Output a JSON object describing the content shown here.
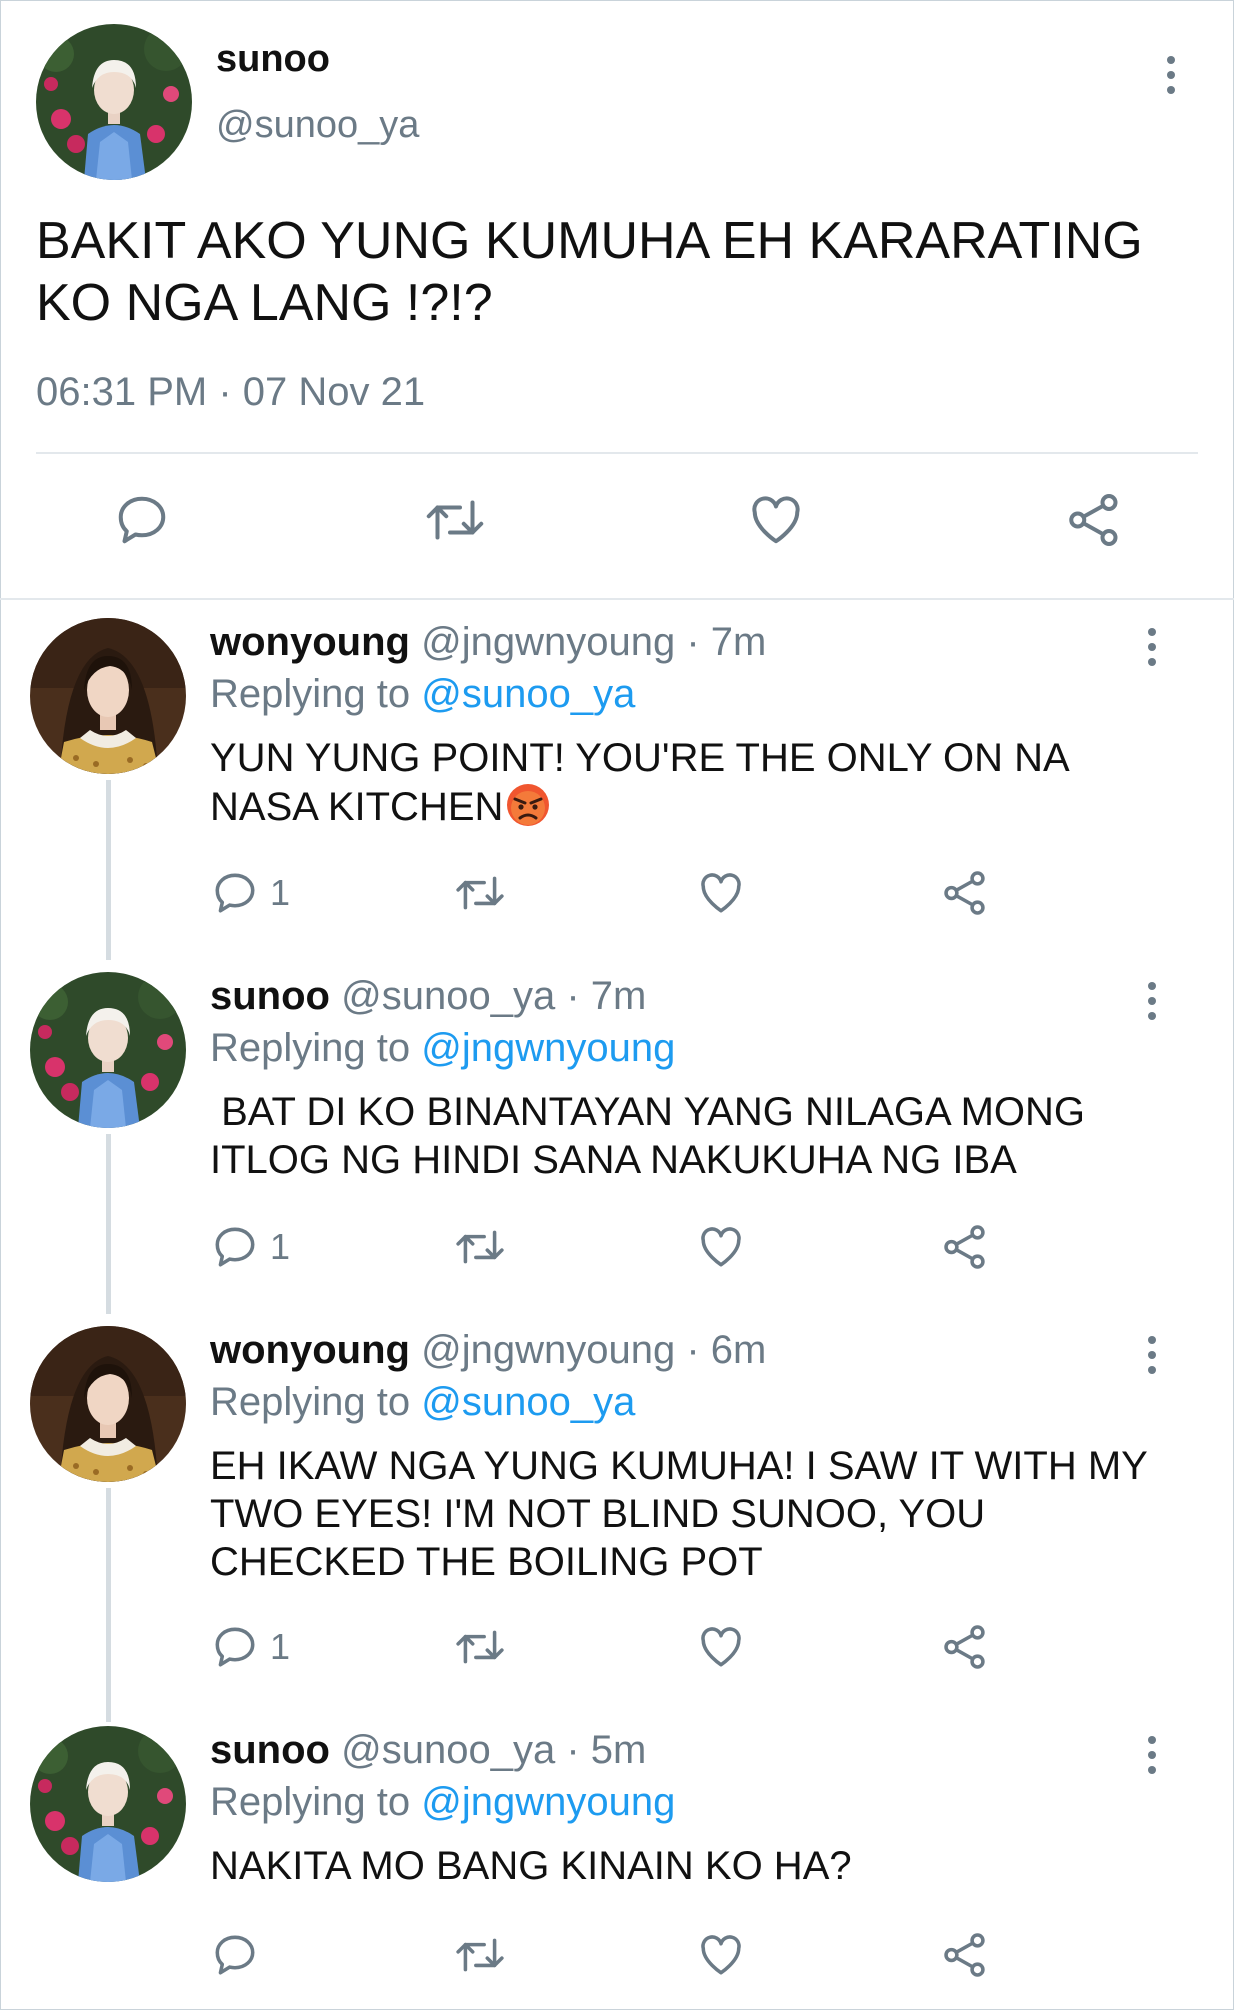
{
  "main_tweet": {
    "name": "sunoo",
    "handle": "@sunoo_ya",
    "text": "BAKIT AKO YUNG KUMUHA EH KARARATING KO NGA LANG !?!?",
    "timestamp": "06:31 PM · 07 Nov 21",
    "actions": [
      "comment-icon",
      "retweet-icon",
      "heart-icon",
      "share-icon"
    ]
  },
  "replies": [
    {
      "name": "wonyoung",
      "handle": "@jngwnyoung",
      "time": "· 7m",
      "replying_label": "Replying to",
      "replying_to": "@sunoo_ya",
      "text": "YUN YUNG POINT! YOU'RE THE ONLY ON NA NASA KITCHEN",
      "emoji": "angry-face-emoji",
      "comment_count": "1"
    },
    {
      "name": "sunoo",
      "handle": "@sunoo_ya",
      "time": "· 7m",
      "replying_label": "Replying to",
      "replying_to": "@jngwnyoung",
      "text": " BAT DI KO BINANTAYAN YANG NILAGA MONG ITLOG NG HINDI SANA NAKUKUHA NG IBA",
      "comment_count": "1"
    },
    {
      "name": "wonyoung",
      "handle": "@jngwnyoung",
      "time": "· 6m",
      "replying_label": "Replying to",
      "replying_to": "@sunoo_ya",
      "text": "EH IKAW NGA YUNG KUMUHA! I SAW IT WITH MY TWO EYES! I'M NOT BLIND SUNOO, YOU CHECKED THE BOILING POT",
      "comment_count": "1"
    },
    {
      "name": "sunoo",
      "handle": "@sunoo_ya",
      "time": "· 5m",
      "replying_label": "Replying to",
      "replying_to": "@jngwnyoung",
      "text": "NAKITA MO BANG KINAIN KO HA?",
      "comment_count": ""
    }
  ],
  "colors": {
    "text": "#111111",
    "muted": "#6b7a86",
    "mention": "#1d9bf0",
    "divider": "#e3e8ec",
    "thread_line": "#d5dce1"
  }
}
